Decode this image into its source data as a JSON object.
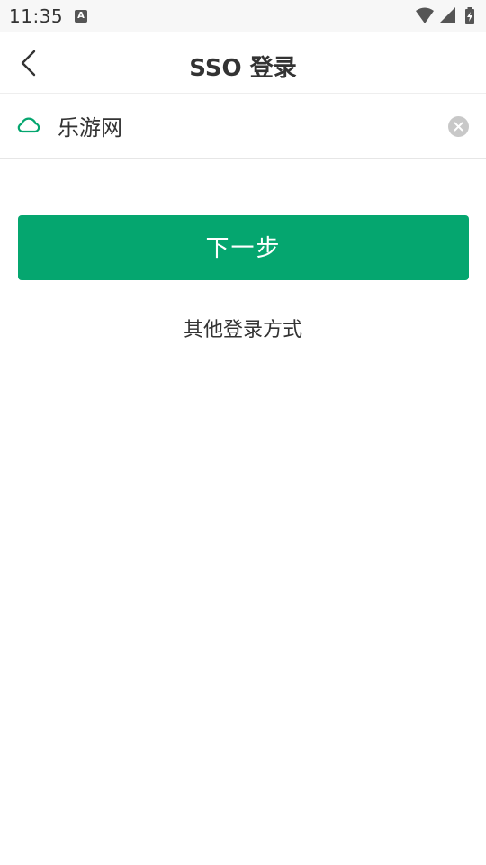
{
  "status_bar": {
    "time": "11:35",
    "notification_icon": "a-icon",
    "wifi_icon": "wifi-icon",
    "signal_icon": "signal-icon",
    "battery_icon": "battery-charging-icon"
  },
  "header": {
    "back_icon": "chevron-left-icon",
    "title": "SSO 登录"
  },
  "domain_field": {
    "icon": "cloud-icon",
    "value": "乐游网",
    "clear_icon": "clear-circle-icon"
  },
  "actions": {
    "next_label": "下一步",
    "other_login_label": "其他登录方式"
  },
  "colors": {
    "accent": "#05a66f",
    "cloud_icon": "#05a66f",
    "clear_icon": "#c8c8c8"
  }
}
